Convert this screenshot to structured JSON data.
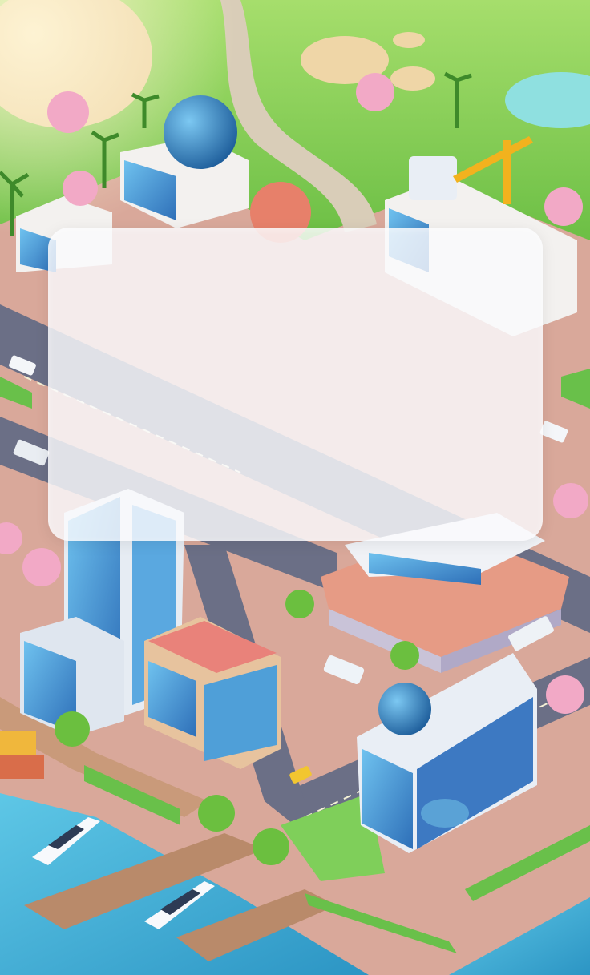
{
  "scene": {
    "name": "isometric-city-game-background",
    "palette": {
      "grass": "#8fd35a",
      "grass_dark": "#6cbf45",
      "sand": "#efd6a7",
      "road": "#6b6f86",
      "water": "#3fb1d8",
      "water_light": "#7fd4ec",
      "dock": "#b98a6a",
      "sidewalk": "#e8b9a6",
      "glass": "#3d8fd0",
      "dome": "#2f7fbe",
      "blossom": "#f2a9c6",
      "crane": "#f2b21e"
    }
  },
  "overlay_panel": {
    "style": "translucent-white-rounded-card",
    "background": "#fafafc",
    "opacity": 0.82,
    "content": []
  }
}
